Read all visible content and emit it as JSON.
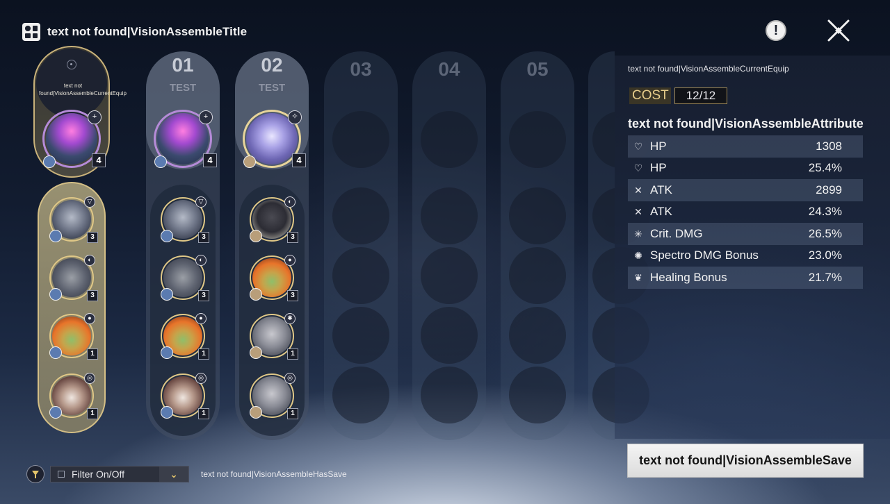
{
  "header": {
    "title": "text not found|VisionAssembleTitle",
    "info_glyph": "!"
  },
  "current": {
    "label": "text not found|VisionAssembleCurrentEquip"
  },
  "columns": [
    {
      "number": "01",
      "tag": "TEST"
    },
    {
      "number": "02",
      "tag": "TEST"
    },
    {
      "number": "03"
    },
    {
      "number": "04"
    },
    {
      "number": "05"
    }
  ],
  "current_echoes": [
    {
      "art": "mech",
      "cost": "4",
      "badge": "+"
    },
    {
      "art": "grey",
      "cost": "3",
      "badge": "▽"
    },
    {
      "art": "ghost",
      "cost": "3",
      "badge": "◐"
    },
    {
      "art": "fire",
      "cost": "1",
      "badge": "●"
    },
    {
      "art": "pig",
      "cost": "1",
      "badge": "◎"
    }
  ],
  "set1_echoes": [
    {
      "art": "mech",
      "cost": "4",
      "badge": "+"
    },
    {
      "art": "grey",
      "cost": "3",
      "badge": "▽"
    },
    {
      "art": "ghost",
      "cost": "3",
      "badge": "◐"
    },
    {
      "art": "fire",
      "cost": "1",
      "badge": "●"
    },
    {
      "art": "pig",
      "cost": "1",
      "badge": "◎"
    }
  ],
  "set2_echoes": [
    {
      "art": "wing",
      "cost": "4",
      "badge": "✧"
    },
    {
      "art": "bear",
      "cost": "3",
      "badge": "◐"
    },
    {
      "art": "fire",
      "cost": "3",
      "badge": "●"
    },
    {
      "art": "rock",
      "cost": "1",
      "badge": "✱"
    },
    {
      "art": "rock",
      "cost": "1",
      "badge": "◎"
    }
  ],
  "panel": {
    "current_equip": "text not found|VisionAssembleCurrentEquip",
    "cost_label": "COST",
    "cost_value": "12/12",
    "attribute_title": "text not found|VisionAssembleAttribute",
    "stats": [
      {
        "icon": "heart-icon",
        "glyph": "♡",
        "name": "HP",
        "value": "1308"
      },
      {
        "icon": "heart-icon",
        "glyph": "♡",
        "name": "HP",
        "value": "25.4%"
      },
      {
        "icon": "crossed-swords-icon",
        "glyph": "✕",
        "name": "ATK",
        "value": "2899"
      },
      {
        "icon": "crossed-swords-icon",
        "glyph": "✕",
        "name": "ATK",
        "value": "24.3%"
      },
      {
        "icon": "crit-burst-icon",
        "glyph": "✳",
        "name": "Crit. DMG",
        "value": "26.5%"
      },
      {
        "icon": "spectro-icon",
        "glyph": "✺",
        "name": "Spectro DMG Bonus",
        "value": "23.0%"
      },
      {
        "icon": "leaf-icon",
        "glyph": "❦",
        "name": "Healing Bonus",
        "value": "21.7%"
      }
    ],
    "save_label": "text not found|VisionAssembleSave"
  },
  "footer": {
    "filter_label": "Filter On/Off",
    "has_save": "text not found|VisionAssembleHasSave"
  }
}
